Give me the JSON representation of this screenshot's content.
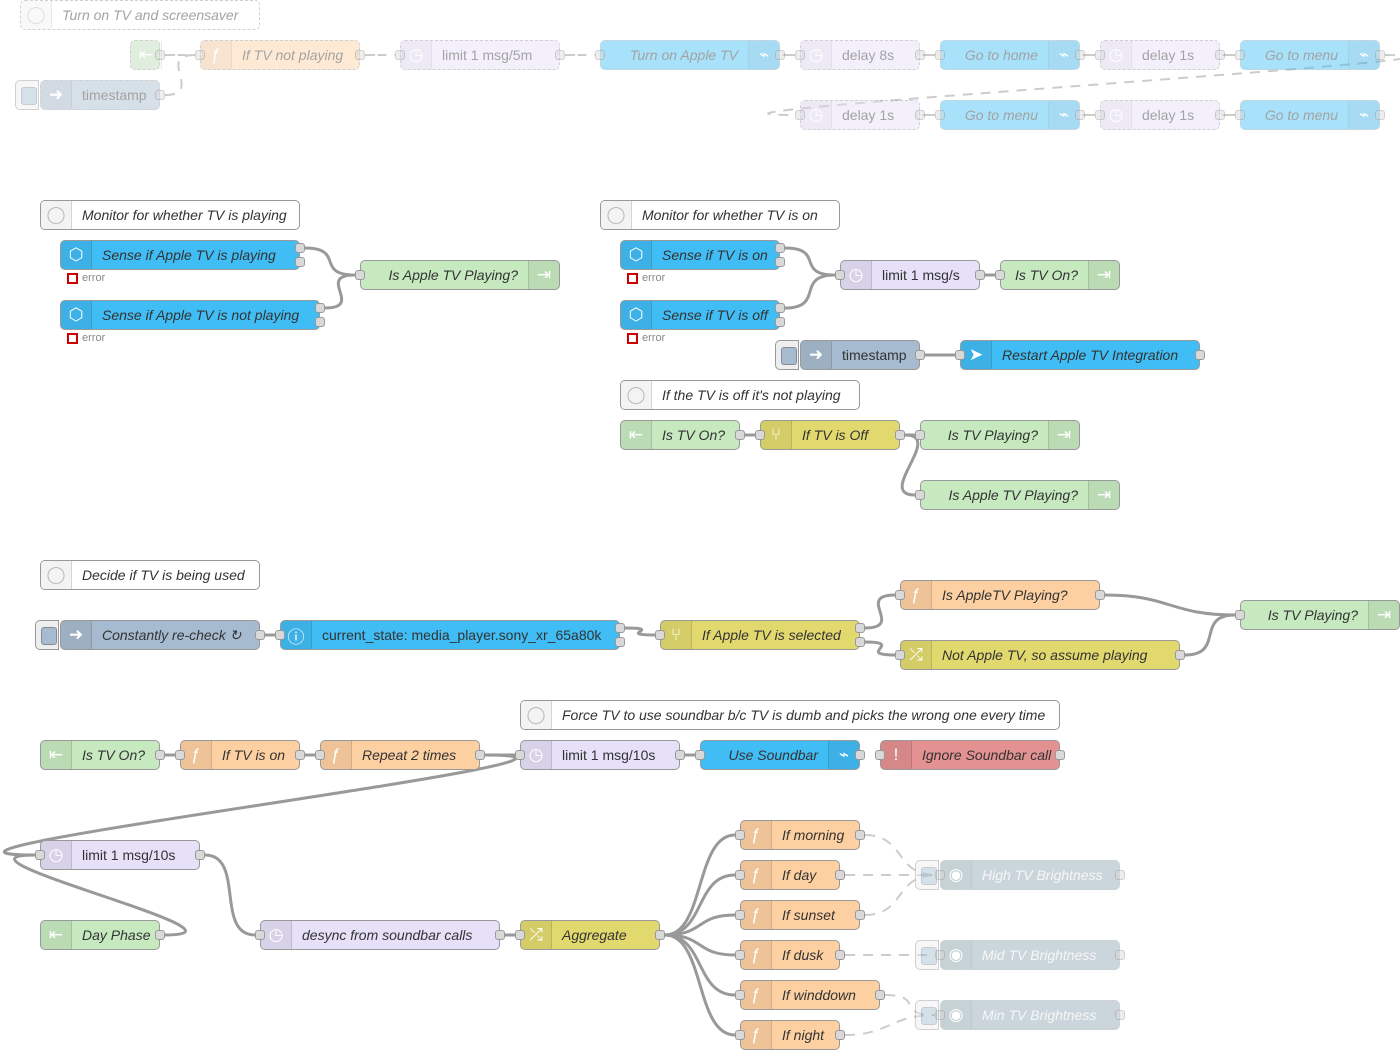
{
  "types": {
    "comment": {
      "color": "#ffffff",
      "icon": "comment-icon",
      "glyph": "◯"
    },
    "inject": {
      "color": "#a6bbcf",
      "icon": "arrow-in-icon",
      "glyph": "➜"
    },
    "function": {
      "color": "#fdd0a2",
      "icon": "function-icon",
      "glyph": "ƒ"
    },
    "delay": {
      "color": "#e6e0f8",
      "icon": "timer-icon",
      "glyph": "◷"
    },
    "ha-api": {
      "color": "#41bdf5",
      "icon": "router-icon",
      "glyph": "⌁"
    },
    "ha-plane": {
      "color": "#41bdf5",
      "icon": "paper-plane-icon",
      "glyph": "➤"
    },
    "ha-event": {
      "color": "#41bdf5",
      "icon": "home-assistant-icon",
      "glyph": "⬡"
    },
    "current-state": {
      "color": "#41bdf5",
      "icon": "info-icon",
      "glyph": "ⓘ"
    },
    "link-out": {
      "color": "#c7e9c0",
      "icon": "link-out-icon",
      "glyph": "⇥"
    },
    "link-in": {
      "color": "#c7e9c0",
      "icon": "link-in-icon",
      "glyph": "⇤"
    },
    "switch": {
      "color": "#e2d96e",
      "icon": "switch-icon",
      "glyph": "⑂"
    },
    "change": {
      "color": "#e2d96e",
      "icon": "shuffle-icon",
      "glyph": "⤮"
    },
    "catch": {
      "color": "#e49191",
      "icon": "alert-icon",
      "glyph": "!"
    },
    "light": {
      "color": "#8ea6b2",
      "icon": "light-icon",
      "glyph": "◉"
    }
  },
  "status_error": "error",
  "nodes": {
    "c1": {
      "type": "comment",
      "label": "Turn on TV and screensaver"
    },
    "li1": {
      "type": "link-in",
      "label": ""
    },
    "f1": {
      "type": "function",
      "label": "If TV not playing"
    },
    "dl1": {
      "type": "delay",
      "label": "limit 1 msg/5m"
    },
    "a1": {
      "type": "ha-api",
      "label": "Turn on Apple TV"
    },
    "dl2": {
      "type": "delay",
      "label": "delay 8s"
    },
    "a2": {
      "type": "ha-api",
      "label": "Go to home"
    },
    "dl3": {
      "type": "delay",
      "label": "delay 1s"
    },
    "a3": {
      "type": "ha-api",
      "label": "Go to menu"
    },
    "in1": {
      "type": "inject",
      "label": "timestamp"
    },
    "dl4": {
      "type": "delay",
      "label": "delay 1s"
    },
    "a4": {
      "type": "ha-api",
      "label": "Go to menu"
    },
    "dl5": {
      "type": "delay",
      "label": "delay 1s"
    },
    "a5": {
      "type": "ha-api",
      "label": "Go to menu"
    },
    "c2": {
      "type": "comment",
      "label": "Monitor for whether TV is playing"
    },
    "ev1": {
      "type": "ha-event",
      "label": "Sense if Apple TV is playing"
    },
    "ev2": {
      "type": "ha-event",
      "label": "Sense if Apple TV is not playing"
    },
    "lo1": {
      "type": "link-out",
      "label": "Is Apple TV Playing?"
    },
    "c3": {
      "type": "comment",
      "label": "Monitor for whether TV is on"
    },
    "ev3": {
      "type": "ha-event",
      "label": "Sense if TV is on"
    },
    "ev4": {
      "type": "ha-event",
      "label": "Sense if TV is off"
    },
    "dl6": {
      "type": "delay",
      "label": "limit 1 msg/s"
    },
    "lo2": {
      "type": "link-out",
      "label": "Is TV On?"
    },
    "in2": {
      "type": "inject",
      "label": "timestamp"
    },
    "a6": {
      "type": "ha-plane",
      "label": "Restart Apple TV Integration"
    },
    "c4": {
      "type": "comment",
      "label": "If the TV is off it's not playing"
    },
    "li2": {
      "type": "link-in",
      "label": "Is TV On?"
    },
    "sw1": {
      "type": "switch",
      "label": "If TV is Off"
    },
    "lo3": {
      "type": "link-out",
      "label": "Is TV Playing?"
    },
    "lo4": {
      "type": "link-out",
      "label": "Is Apple TV Playing?"
    },
    "c5": {
      "type": "comment",
      "label": "Decide if TV is being used"
    },
    "in3": {
      "type": "inject",
      "label": "Constantly re-check ↻"
    },
    "cs1": {
      "type": "current-state",
      "label": "current_state: media_player.sony_xr_65a80k"
    },
    "sw2": {
      "type": "switch",
      "label": "If Apple TV is selected"
    },
    "f2": {
      "type": "function",
      "label": "Is AppleTV Playing?"
    },
    "ch1": {
      "type": "change",
      "label": "Not Apple TV, so assume playing"
    },
    "lo5": {
      "type": "link-out",
      "label": "Is TV Playing?"
    },
    "c6": {
      "type": "comment",
      "label": "Force TV to use soundbar b/c TV is dumb and picks the wrong one every time"
    },
    "li3": {
      "type": "link-in",
      "label": "Is TV On?"
    },
    "f3": {
      "type": "function",
      "label": "If TV is on"
    },
    "f4": {
      "type": "function",
      "label": "Repeat 2 times"
    },
    "dl7": {
      "type": "delay",
      "label": "limit 1 msg/10s"
    },
    "a7": {
      "type": "ha-api",
      "label": "Use Soundbar"
    },
    "ct1": {
      "type": "catch",
      "label": "Ignore Soundbar call"
    },
    "dl8": {
      "type": "delay",
      "label": "limit 1 msg/10s"
    },
    "li4": {
      "type": "link-in",
      "label": "Day Phase"
    },
    "dl9": {
      "type": "delay",
      "label": "desync from soundbar calls"
    },
    "ch2": {
      "type": "change",
      "label": "Aggregate"
    },
    "f5": {
      "type": "function",
      "label": "If morning"
    },
    "f6": {
      "type": "function",
      "label": "If day"
    },
    "f7": {
      "type": "function",
      "label": "If sunset"
    },
    "f8": {
      "type": "function",
      "label": "If dusk"
    },
    "f9": {
      "type": "function",
      "label": "If winddown"
    },
    "f10": {
      "type": "function",
      "label": "If night"
    },
    "l1": {
      "type": "light",
      "label": "High TV Brightness"
    },
    "l2": {
      "type": "light",
      "label": "Mid TV Brightness"
    },
    "l3": {
      "type": "light",
      "label": "Min TV Brightness"
    }
  }
}
